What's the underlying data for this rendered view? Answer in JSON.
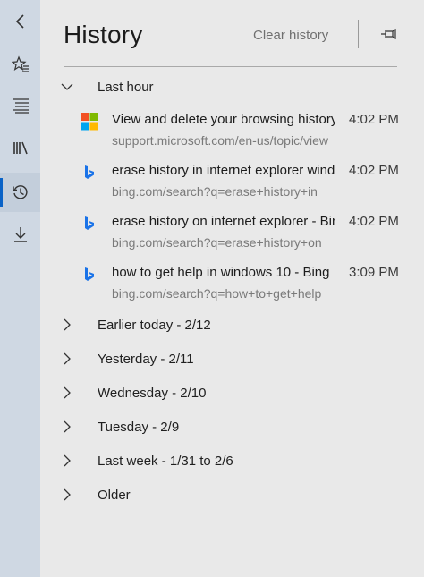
{
  "rail": {
    "icons": [
      "back-icon",
      "favorites-icon",
      "reading-list-icon",
      "books-icon",
      "history-icon",
      "downloads-icon"
    ]
  },
  "panel": {
    "title": "History",
    "clear_label": "Clear history"
  },
  "sections": {
    "last_hour": "Last hour",
    "items": [
      {
        "title": "View and delete your browsing history",
        "url": "support.microsoft.com/en-us/topic/view",
        "time": "4:02 PM",
        "icon": "microsoft-logo"
      },
      {
        "title": "erase history in internet explorer windows",
        "url": "bing.com/search?q=erase+history+in",
        "time": "4:02 PM",
        "icon": "bing-logo"
      },
      {
        "title": "erase history on internet explorer - Bing",
        "url": "bing.com/search?q=erase+history+on",
        "time": "4:02 PM",
        "icon": "bing-logo"
      },
      {
        "title": "how to get help in windows 10 - Bing",
        "url": "bing.com/search?q=how+to+get+help",
        "time": "3:09 PM",
        "icon": "bing-logo"
      }
    ],
    "groups": [
      "Earlier today - 2/12",
      "Yesterday - 2/11",
      "Wednesday - 2/10",
      "Tuesday - 2/9",
      "Last week - 1/31 to 2/6",
      "Older"
    ]
  },
  "colors": {
    "rail_bg": "#cfd8e3",
    "panel_bg": "#e9e9e9",
    "accent": "#0a63c7"
  }
}
